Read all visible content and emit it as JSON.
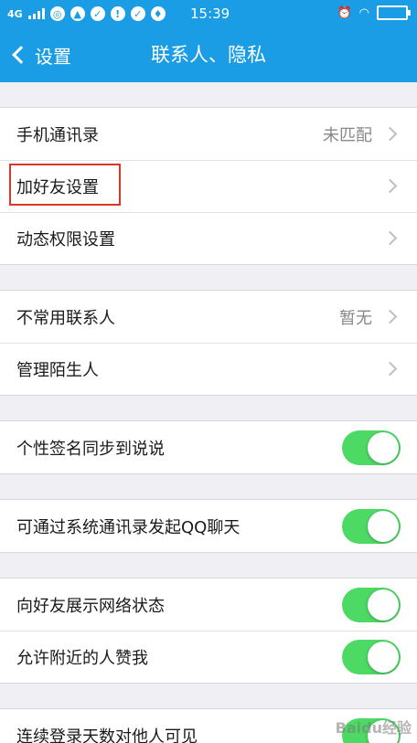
{
  "status_bar": {
    "network": "4G",
    "time": "15:39"
  },
  "nav": {
    "back_label": "设置",
    "title": "联系人、隐私"
  },
  "groups": [
    {
      "rows": [
        {
          "label": "手机通讯录",
          "value": "未匹配",
          "type": "link"
        },
        {
          "label": "加好友设置",
          "value": "",
          "type": "link"
        },
        {
          "label": "动态权限设置",
          "value": "",
          "type": "link"
        }
      ]
    },
    {
      "rows": [
        {
          "label": "不常用联系人",
          "value": "暂无",
          "type": "link"
        },
        {
          "label": "管理陌生人",
          "value": "",
          "type": "link"
        }
      ]
    },
    {
      "rows": [
        {
          "label": "个性签名同步到说说",
          "type": "toggle",
          "on": true
        }
      ]
    },
    {
      "rows": [
        {
          "label": "可通过系统通讯录发起QQ聊天",
          "type": "toggle",
          "on": true
        }
      ]
    },
    {
      "rows": [
        {
          "label": "向好友展示网络状态",
          "type": "toggle",
          "on": true
        },
        {
          "label": "允许附近的人赞我",
          "type": "toggle",
          "on": true
        }
      ]
    },
    {
      "rows": [
        {
          "label": "连续登录天数对他人可见",
          "type": "toggle",
          "on": true
        }
      ]
    }
  ],
  "watermark": "Baidu经验",
  "colors": {
    "accent": "#1a9de4",
    "toggle_on": "#4cd964",
    "highlight": "#d9372c"
  }
}
